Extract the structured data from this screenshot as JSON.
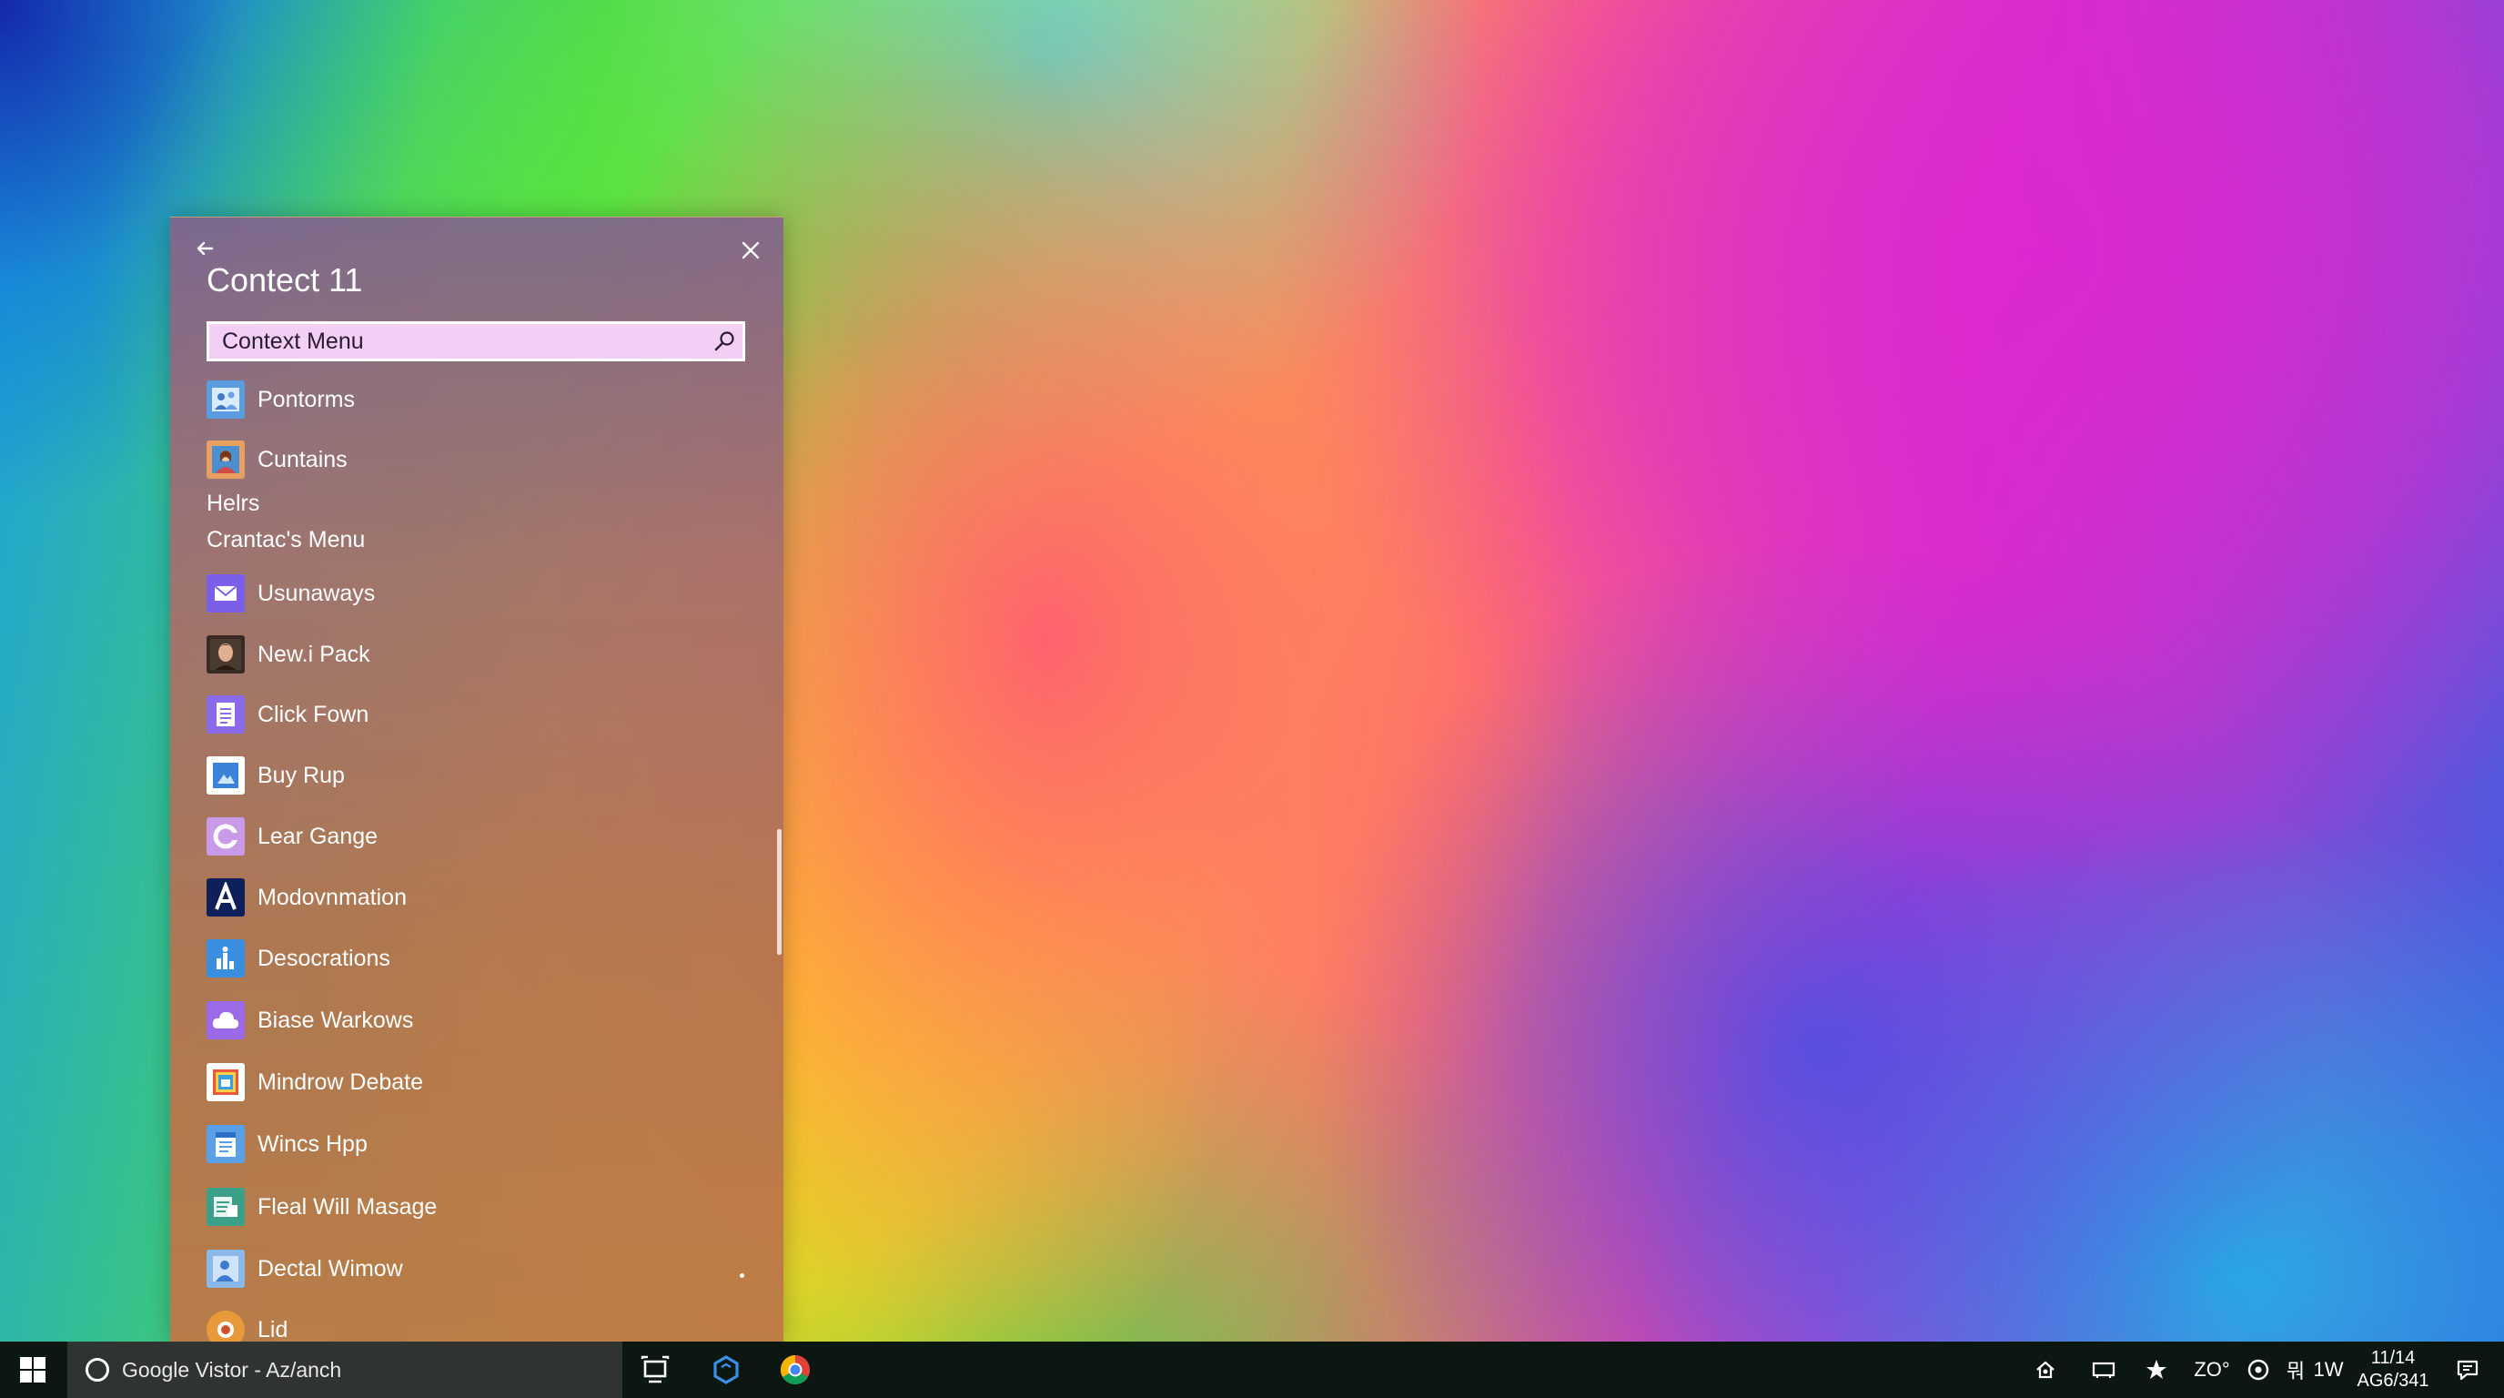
{
  "panel": {
    "title": "Contect 11",
    "search": {
      "value": "Context Menu",
      "icon": "search-icon"
    },
    "items_top": [
      {
        "label": "Pontorms",
        "icon": "people-icon"
      },
      {
        "label": "Cuntains",
        "icon": "contact-photo-icon"
      }
    ],
    "section_labels": [
      "Helrs",
      "Crantac's Menu"
    ],
    "items": [
      {
        "label": "Usunaways",
        "icon": "mail-icon"
      },
      {
        "label": "New.i Pack",
        "icon": "person-photo-icon"
      },
      {
        "label": "Click Fown",
        "icon": "document-list-icon"
      },
      {
        "label": "Buy Rup",
        "icon": "picture-icon"
      },
      {
        "label": "Lear Gange",
        "icon": "refresh-circle-icon"
      },
      {
        "label": "Modovnmation",
        "icon": "letter-a-icon"
      },
      {
        "label": "Desocrations",
        "icon": "chart-people-icon"
      },
      {
        "label": "Biase Warkows",
        "icon": "cloud-icon"
      },
      {
        "label": "Mindrow Debate",
        "icon": "gallery-icon"
      },
      {
        "label": "Wincs Hpp",
        "icon": "notepad-icon"
      },
      {
        "label": "Fleal Will Masage",
        "icon": "message-board-icon"
      },
      {
        "label": "Dectal Wimow",
        "icon": "user-card-icon"
      },
      {
        "label": "Lid",
        "icon": "app-icon"
      }
    ]
  },
  "taskbar": {
    "search_text": "Google Vistor - Az/anch",
    "apps": [
      "task-view-icon",
      "hexagon-app-icon",
      "chrome-icon"
    ],
    "tray": {
      "status_text_1": "ZO°",
      "status_text_2": "1W",
      "language_indicator": "뭐"
    },
    "clock": {
      "time": "11/14",
      "date": "AG6/341"
    }
  }
}
